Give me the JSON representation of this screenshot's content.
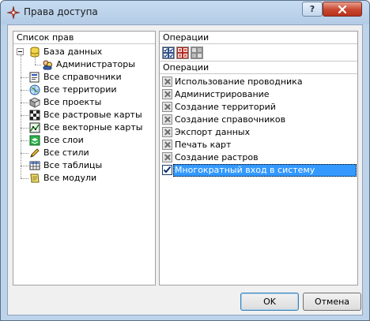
{
  "window": {
    "title": "Права доступа",
    "help_label": "?",
    "close_label": "X"
  },
  "left_pane": {
    "header": "Список прав",
    "tree": [
      {
        "label": "База данных",
        "icon": "database-icon",
        "level": 0,
        "expanded": true
      },
      {
        "label": "Администраторы",
        "icon": "admin-group-icon",
        "level": 1,
        "selected": false
      },
      {
        "label": "Все справочники",
        "icon": "reference-book-icon",
        "level": 0
      },
      {
        "label": "Все территории",
        "icon": "territory-globe-icon",
        "level": 0
      },
      {
        "label": "Все проекты",
        "icon": "project-icon",
        "level": 0
      },
      {
        "label": "Все растровые карты",
        "icon": "raster-map-icon",
        "level": 0
      },
      {
        "label": "Все векторные карты",
        "icon": "vector-map-icon",
        "level": 0
      },
      {
        "label": "Все слои",
        "icon": "layers-icon",
        "level": 0
      },
      {
        "label": "Все стили",
        "icon": "pencil-style-icon",
        "level": 0
      },
      {
        "label": "Все таблицы",
        "icon": "table-icon",
        "level": 0
      },
      {
        "label": "Все модули",
        "icon": "module-icon",
        "level": 0
      }
    ]
  },
  "right_pane": {
    "header": "Операции",
    "toolbar": [
      {
        "name": "check-all-icon"
      },
      {
        "name": "uncheck-all-icon"
      },
      {
        "name": "reset-icon"
      }
    ],
    "column_header": "Операции",
    "operations": [
      {
        "label": "Использование проводника",
        "checked": false
      },
      {
        "label": "Администрирование",
        "checked": false
      },
      {
        "label": "Создание территорий",
        "checked": false
      },
      {
        "label": "Создание справочников",
        "checked": false
      },
      {
        "label": "Экспорт данных",
        "checked": false
      },
      {
        "label": "Печать карт",
        "checked": false
      },
      {
        "label": "Создание растров",
        "checked": false
      },
      {
        "label": "Многократный вход в систему",
        "checked": true,
        "selected": true
      }
    ]
  },
  "buttons": {
    "ok": "OK",
    "cancel": "Отмена"
  },
  "colors": {
    "frame": "#bcd3ea",
    "selection": "#3399ff",
    "close": "#c9462f"
  }
}
